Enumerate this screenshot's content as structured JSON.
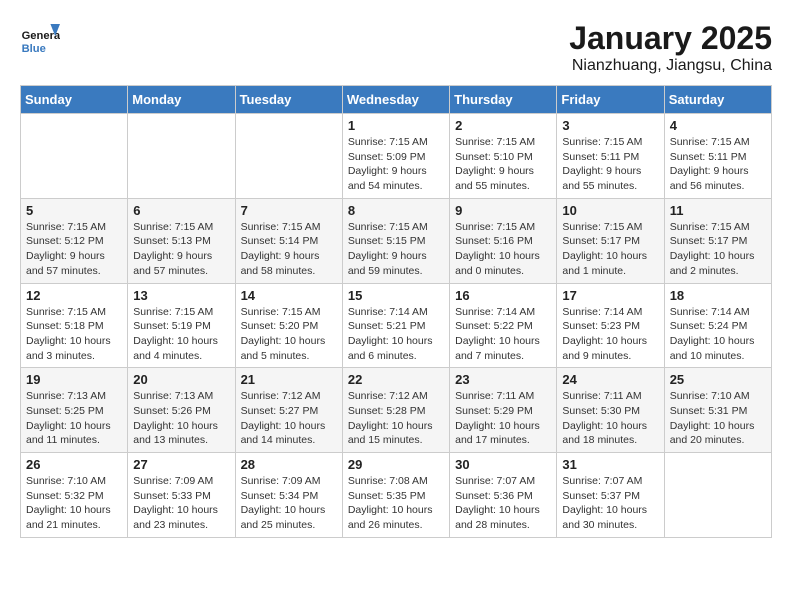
{
  "header": {
    "logo_line1": "General",
    "logo_line2": "Blue",
    "title": "January 2025",
    "subtitle": "Nianzhuang, Jiangsu, China"
  },
  "weekdays": [
    "Sunday",
    "Monday",
    "Tuesday",
    "Wednesday",
    "Thursday",
    "Friday",
    "Saturday"
  ],
  "weeks": [
    [
      {
        "day": "",
        "info": ""
      },
      {
        "day": "",
        "info": ""
      },
      {
        "day": "",
        "info": ""
      },
      {
        "day": "1",
        "info": "Sunrise: 7:15 AM\nSunset: 5:09 PM\nDaylight: 9 hours\nand 54 minutes."
      },
      {
        "day": "2",
        "info": "Sunrise: 7:15 AM\nSunset: 5:10 PM\nDaylight: 9 hours\nand 55 minutes."
      },
      {
        "day": "3",
        "info": "Sunrise: 7:15 AM\nSunset: 5:11 PM\nDaylight: 9 hours\nand 55 minutes."
      },
      {
        "day": "4",
        "info": "Sunrise: 7:15 AM\nSunset: 5:11 PM\nDaylight: 9 hours\nand 56 minutes."
      }
    ],
    [
      {
        "day": "5",
        "info": "Sunrise: 7:15 AM\nSunset: 5:12 PM\nDaylight: 9 hours\nand 57 minutes."
      },
      {
        "day": "6",
        "info": "Sunrise: 7:15 AM\nSunset: 5:13 PM\nDaylight: 9 hours\nand 57 minutes."
      },
      {
        "day": "7",
        "info": "Sunrise: 7:15 AM\nSunset: 5:14 PM\nDaylight: 9 hours\nand 58 minutes."
      },
      {
        "day": "8",
        "info": "Sunrise: 7:15 AM\nSunset: 5:15 PM\nDaylight: 9 hours\nand 59 minutes."
      },
      {
        "day": "9",
        "info": "Sunrise: 7:15 AM\nSunset: 5:16 PM\nDaylight: 10 hours\nand 0 minutes."
      },
      {
        "day": "10",
        "info": "Sunrise: 7:15 AM\nSunset: 5:17 PM\nDaylight: 10 hours\nand 1 minute."
      },
      {
        "day": "11",
        "info": "Sunrise: 7:15 AM\nSunset: 5:17 PM\nDaylight: 10 hours\nand 2 minutes."
      }
    ],
    [
      {
        "day": "12",
        "info": "Sunrise: 7:15 AM\nSunset: 5:18 PM\nDaylight: 10 hours\nand 3 minutes."
      },
      {
        "day": "13",
        "info": "Sunrise: 7:15 AM\nSunset: 5:19 PM\nDaylight: 10 hours\nand 4 minutes."
      },
      {
        "day": "14",
        "info": "Sunrise: 7:15 AM\nSunset: 5:20 PM\nDaylight: 10 hours\nand 5 minutes."
      },
      {
        "day": "15",
        "info": "Sunrise: 7:14 AM\nSunset: 5:21 PM\nDaylight: 10 hours\nand 6 minutes."
      },
      {
        "day": "16",
        "info": "Sunrise: 7:14 AM\nSunset: 5:22 PM\nDaylight: 10 hours\nand 7 minutes."
      },
      {
        "day": "17",
        "info": "Sunrise: 7:14 AM\nSunset: 5:23 PM\nDaylight: 10 hours\nand 9 minutes."
      },
      {
        "day": "18",
        "info": "Sunrise: 7:14 AM\nSunset: 5:24 PM\nDaylight: 10 hours\nand 10 minutes."
      }
    ],
    [
      {
        "day": "19",
        "info": "Sunrise: 7:13 AM\nSunset: 5:25 PM\nDaylight: 10 hours\nand 11 minutes."
      },
      {
        "day": "20",
        "info": "Sunrise: 7:13 AM\nSunset: 5:26 PM\nDaylight: 10 hours\nand 13 minutes."
      },
      {
        "day": "21",
        "info": "Sunrise: 7:12 AM\nSunset: 5:27 PM\nDaylight: 10 hours\nand 14 minutes."
      },
      {
        "day": "22",
        "info": "Sunrise: 7:12 AM\nSunset: 5:28 PM\nDaylight: 10 hours\nand 15 minutes."
      },
      {
        "day": "23",
        "info": "Sunrise: 7:11 AM\nSunset: 5:29 PM\nDaylight: 10 hours\nand 17 minutes."
      },
      {
        "day": "24",
        "info": "Sunrise: 7:11 AM\nSunset: 5:30 PM\nDaylight: 10 hours\nand 18 minutes."
      },
      {
        "day": "25",
        "info": "Sunrise: 7:10 AM\nSunset: 5:31 PM\nDaylight: 10 hours\nand 20 minutes."
      }
    ],
    [
      {
        "day": "26",
        "info": "Sunrise: 7:10 AM\nSunset: 5:32 PM\nDaylight: 10 hours\nand 21 minutes."
      },
      {
        "day": "27",
        "info": "Sunrise: 7:09 AM\nSunset: 5:33 PM\nDaylight: 10 hours\nand 23 minutes."
      },
      {
        "day": "28",
        "info": "Sunrise: 7:09 AM\nSunset: 5:34 PM\nDaylight: 10 hours\nand 25 minutes."
      },
      {
        "day": "29",
        "info": "Sunrise: 7:08 AM\nSunset: 5:35 PM\nDaylight: 10 hours\nand 26 minutes."
      },
      {
        "day": "30",
        "info": "Sunrise: 7:07 AM\nSunset: 5:36 PM\nDaylight: 10 hours\nand 28 minutes."
      },
      {
        "day": "31",
        "info": "Sunrise: 7:07 AM\nSunset: 5:37 PM\nDaylight: 10 hours\nand 30 minutes."
      },
      {
        "day": "",
        "info": ""
      }
    ]
  ]
}
